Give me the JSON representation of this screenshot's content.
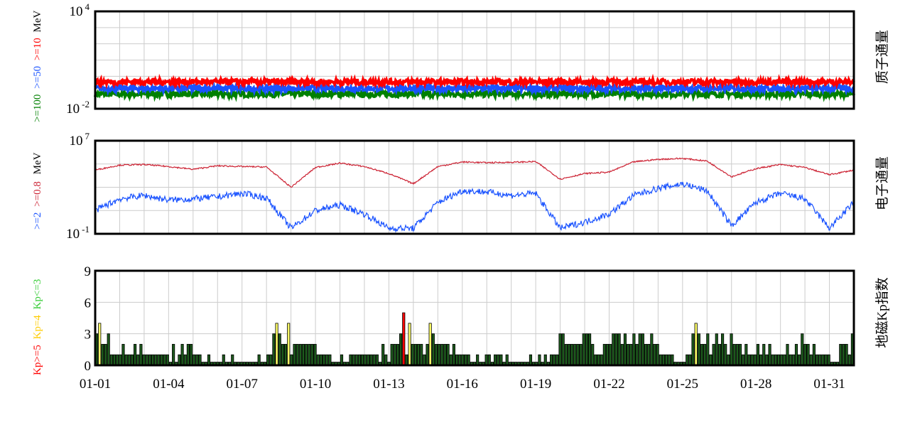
{
  "chart_data": [
    {
      "type": "line",
      "title": "质子通量",
      "yscale": "log",
      "ylim": [
        0.01,
        10000
      ],
      "ytick_labels": [
        {
          "base": "10",
          "exp": "4"
        },
        {
          "base": "10",
          "exp": "-2"
        }
      ],
      "ylabel_parts": [
        {
          "text": ">=100",
          "color": "#008000"
        },
        {
          "text": ">=50",
          "color": "#1a53ff"
        },
        {
          "text": ">=10",
          "color": "#ff0000"
        },
        {
          "text": "MeV",
          "color": "#000000"
        }
      ],
      "grid": true,
      "series": [
        {
          "name": ">=10",
          "color": "#ff0000",
          "approx_value": 0.45
        },
        {
          "name": ">=50",
          "color": "#1a53ff",
          "approx_value": 0.18
        },
        {
          "name": ">=100",
          "color": "#008000",
          "approx_value": 0.08
        }
      ]
    },
    {
      "type": "line",
      "title": "电子通量",
      "yscale": "log",
      "ylim": [
        0.1,
        10000000
      ],
      "ytick_labels": [
        {
          "base": "10",
          "exp": "7"
        },
        {
          "base": "10",
          "exp": "-1"
        }
      ],
      "ylabel_parts": [
        {
          "text": ">=2",
          "color": "#1a53ff"
        },
        {
          "text": ">=0.8",
          "color": "#cc2233"
        },
        {
          "text": "MeV",
          "color": "#000000"
        }
      ],
      "grid": true,
      "x_days": [
        1,
        2,
        3,
        4,
        5,
        6,
        7,
        8,
        9,
        10,
        11,
        12,
        13,
        14,
        15,
        16,
        17,
        18,
        19,
        20,
        21,
        22,
        23,
        24,
        25,
        26,
        27,
        28,
        29,
        30,
        31,
        32
      ],
      "series": [
        {
          "name": ">=0.8",
          "color": "#cc2233",
          "values": [
            30000,
            80000,
            90000,
            60000,
            35000,
            70000,
            60000,
            55000,
            1000,
            50000,
            120000,
            60000,
            15000,
            2000,
            60000,
            150000,
            130000,
            140000,
            160000,
            5000,
            15000,
            20000,
            150000,
            250000,
            300000,
            180000,
            8000,
            40000,
            90000,
            50000,
            12000,
            30000
          ]
        },
        {
          "name": ">=2",
          "color": "#1a53ff",
          "values": [
            10,
            100,
            200,
            80,
            100,
            150,
            300,
            120,
            0.3,
            10,
            30,
            5,
            0.3,
            0.3,
            50,
            500,
            400,
            200,
            300,
            0.3,
            1,
            5,
            200,
            800,
            2000,
            500,
            0.5,
            50,
            300,
            100,
            0.3,
            50
          ]
        }
      ]
    },
    {
      "type": "bar",
      "title": "地磁Kp指数",
      "ylim": [
        0,
        9
      ],
      "yticks": [
        "9",
        "6",
        "3",
        "0"
      ],
      "ylabel_parts": [
        {
          "text": "Kp>=5",
          "color": "#ff0000"
        },
        {
          "text": "Kp=4",
          "color": "#ffcc00"
        },
        {
          "text": "Kp<=3",
          "color": "#33cc33"
        }
      ],
      "xtick_labels": [
        "01-01",
        "01-04",
        "01-07",
        "01-10",
        "01-13",
        "01-16",
        "01-19",
        "01-22",
        "01-25",
        "01-28",
        "01-31"
      ],
      "grid": true,
      "colors": {
        "low": "#1d5a1d",
        "mid": "#ffff66",
        "high": "#ff0000",
        "edge": "#000000"
      },
      "interval_hours": 3,
      "kp_values": [
        3,
        4,
        2,
        2,
        3,
        1,
        1,
        1,
        1,
        2,
        1,
        1,
        1,
        2,
        1,
        2,
        1,
        1,
        1,
        1,
        1,
        1,
        1,
        1,
        1,
        0.3,
        2,
        0.3,
        1,
        2,
        1,
        2,
        2,
        1,
        1,
        1,
        0.3,
        0.3,
        1,
        0.3,
        0.3,
        0.3,
        0.3,
        1,
        0.3,
        0.3,
        1,
        0.3,
        0.3,
        0.3,
        0.3,
        0.3,
        0.3,
        0.3,
        0.3,
        1,
        0.3,
        0.3,
        1,
        1,
        3,
        4,
        3,
        2,
        2,
        4,
        1,
        2,
        2,
        2,
        2,
        2,
        2,
        2,
        2,
        1,
        1,
        1,
        1,
        1,
        0.3,
        0.3,
        0.3,
        1,
        0.3,
        0.3,
        1,
        1,
        1,
        1,
        1,
        1,
        1,
        1,
        1,
        1,
        0.3,
        2,
        1,
        0.3,
        2,
        2,
        2,
        3,
        5,
        1,
        4,
        2,
        2,
        2,
        2,
        1,
        2,
        4,
        3,
        2,
        2,
        2,
        2,
        2,
        1,
        2,
        1,
        1,
        1,
        1,
        1,
        0.3,
        0.3,
        1,
        0.3,
        0.3,
        1,
        1,
        0.3,
        1,
        1,
        1,
        0.3,
        1,
        0.3,
        0.3,
        0.3,
        0.3,
        0.3,
        0.3,
        0.3,
        1,
        0.3,
        0.3,
        1,
        0.3,
        1,
        0.3,
        1,
        1,
        1,
        3,
        3,
        2,
        2,
        2,
        2,
        2,
        2,
        3,
        3,
        3,
        2,
        1,
        1,
        1,
        2,
        2,
        2,
        3,
        3,
        3,
        2,
        3,
        2,
        2,
        3,
        2,
        3,
        3,
        2,
        2,
        3,
        2,
        2,
        1,
        1,
        1,
        1,
        1,
        0.3,
        0.3,
        0.3,
        0.3,
        1,
        1,
        3,
        4,
        3,
        2,
        2,
        3,
        1,
        2,
        3,
        2,
        3,
        2,
        1,
        3,
        2,
        2,
        2,
        1,
        2,
        1,
        1,
        1,
        2,
        1,
        2,
        1,
        2,
        1,
        1,
        1,
        1,
        1,
        2,
        1,
        1,
        2,
        1,
        3,
        2,
        2,
        1,
        2,
        1,
        1,
        1,
        1,
        1,
        0.3,
        0.3,
        0.3,
        2,
        2,
        2,
        1,
        3
      ]
    }
  ]
}
